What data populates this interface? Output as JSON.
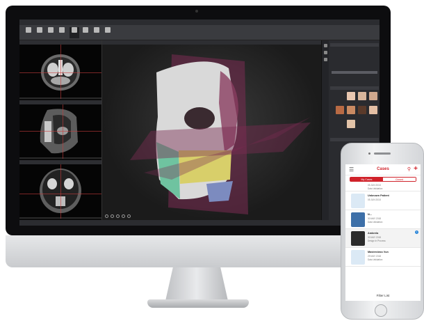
{
  "desktop_app": {
    "title": "",
    "tabs": [
      "",
      "",
      ""
    ],
    "ribbon_buttons": [
      "",
      "",
      "",
      "",
      "",
      "",
      "",
      ""
    ],
    "left_views": [
      "",
      "",
      ""
    ],
    "center_header": "",
    "right_panel": {
      "sections": [
        "",
        "",
        ""
      ],
      "items": [
        "",
        "",
        "",
        "",
        "",
        "",
        "",
        ""
      ],
      "thumbnails": [
        "",
        "",
        "",
        "",
        "",
        "",
        "",
        ""
      ]
    },
    "status": ""
  },
  "mobile_app": {
    "title": "Cases",
    "segments": {
      "my_cases": "My Cases",
      "closed": "Closed"
    },
    "cases": [
      {
        "name": "",
        "date": "05 JUN 2018",
        "status": "Data Validation"
      },
      {
        "name": "Unknown Patient",
        "date": "05 JUN 2018",
        "status": ""
      },
      {
        "name": "N...",
        "date": "30 MAY 2018",
        "status": "Data Validation"
      },
      {
        "name": "Ambrela",
        "date": "30 MAY 2018",
        "status": "Design in Process",
        "badge": "1"
      },
      {
        "name": "Masterclass Vun",
        "date": "29 MAY 2018",
        "status": "Data Validation"
      }
    ],
    "footer": "Filter List"
  },
  "colors": {
    "accent": "#d0222a",
    "plane": "#7a2c52",
    "badge": "#2a86d9"
  }
}
